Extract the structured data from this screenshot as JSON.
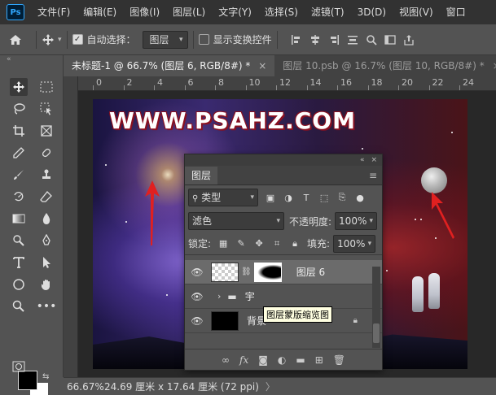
{
  "app": {
    "logo_text": "Ps"
  },
  "menu": [
    "文件(F)",
    "编辑(E)",
    "图像(I)",
    "图层(L)",
    "文字(Y)",
    "选择(S)",
    "滤镜(T)",
    "3D(D)",
    "视图(V)",
    "窗口"
  ],
  "options": {
    "auto_select_label": "自动选择：",
    "auto_select_checked": true,
    "auto_select_target": "图层",
    "show_transform_label": "显示变换控件",
    "show_transform_checked": false
  },
  "tabs": [
    {
      "label": "未标题-1 @ 66.7% (图层 6, RGB/8#) *",
      "close": "×",
      "active": true
    },
    {
      "label": "图层 10.psb @ 16.7% (图层 10, RGB/8#) *",
      "close": "×",
      "active": false
    }
  ],
  "ruler": {
    "h_labels": [
      "0",
      "2",
      "4",
      "6",
      "8",
      "10",
      "12",
      "14",
      "16",
      "18",
      "20",
      "22",
      "24"
    ]
  },
  "canvas": {
    "watermark": "WWW.PSAHZ.COM"
  },
  "layers_panel": {
    "title": "图层",
    "filter_kind": "类型",
    "blend_mode": "滤色",
    "opacity_label": "不透明度:",
    "opacity_value": "100%",
    "lock_label": "锁定:",
    "fill_label": "填充:",
    "fill_value": "100%",
    "layers": [
      {
        "name": "图层 6",
        "selected": true,
        "visible": true,
        "type": "image-with-mask"
      },
      {
        "name": "宇",
        "selected": false,
        "visible": true,
        "type": "group"
      },
      {
        "name": "背景",
        "selected": false,
        "visible": true,
        "type": "background",
        "locked": true
      }
    ],
    "bottom_icons": [
      "link-icon",
      "fx-icon",
      "mask-icon",
      "adjustment-icon",
      "folder-icon",
      "new-layer-icon",
      "trash-icon"
    ]
  },
  "tooltip": "图层蒙版缩览图",
  "status": {
    "zoom": "66.67%",
    "dimensions": "24.69 厘米 x 17.64 厘米 (72 ppi)",
    "more": "〉"
  }
}
